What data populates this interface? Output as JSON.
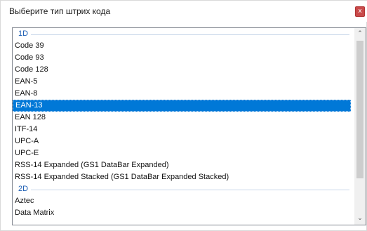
{
  "dialog": {
    "title": "Выберите тип штрих кода",
    "close_glyph": "x"
  },
  "list": {
    "selected_index": 5,
    "groups": [
      {
        "header": "1D",
        "items": [
          "Code 39",
          "Code 93",
          "Code 128",
          "EAN-5",
          "EAN-8",
          "EAN-13",
          "EAN 128",
          "ITF-14",
          "UPC-A",
          "UPC-E",
          "RSS-14 Expanded (GS1 DataBar Expanded)",
          "RSS-14 Expanded Stacked (GS1 DataBar Expanded Stacked)"
        ]
      },
      {
        "header": "2D",
        "items": [
          "Aztec",
          "Data Matrix"
        ]
      }
    ]
  },
  "scrollbar": {
    "up_glyph": "⌃",
    "down_glyph": "⌄"
  },
  "icons": {
    "close": "close-icon",
    "scroll_up": "chevron-up-icon",
    "scroll_down": "chevron-down-icon"
  }
}
